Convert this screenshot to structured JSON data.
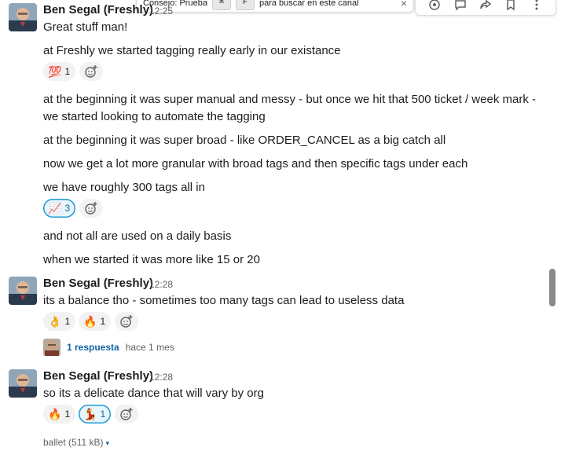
{
  "tooltip": {
    "prefix": "Consejo: Prueba",
    "key1": "⌘",
    "key2": "F",
    "suffix": "para buscar en este canal",
    "close": "×"
  },
  "messages": [
    {
      "author": "Ben Segal (Freshly)",
      "time": "12:25",
      "lines": [
        "Great stuff man!",
        "at Freshly we started tagging really early in our existance"
      ]
    },
    {
      "lines": [
        "at the beginning it was super manual and messy - but once we hit that 500 ticket / week mark -",
        "we started looking to automate the tagging",
        "at the beginning it was super broad - like ORDER_CANCEL as a big catch all",
        "now we get a lot more granular with broad tags and then specific tags under each",
        "we have roughly 300 tags all in"
      ]
    },
    {
      "lines": [
        "and not all are used on a daily basis",
        "when we started it was more like 15 or 20"
      ]
    },
    {
      "author": "Ben Segal (Freshly)",
      "time": "12:28",
      "lines": [
        "its a balance tho - sometimes too many tags can lead to useless data"
      ]
    },
    {
      "author": "Ben Segal (Freshly)",
      "time": "12:28",
      "lines": [
        "so its a delicate dance that will vary by org"
      ]
    }
  ],
  "reactions": {
    "r1": {
      "emoji": "💯",
      "count": "1"
    },
    "r2": {
      "emoji": "📈",
      "count": "3"
    },
    "r3a": {
      "emoji": "👌",
      "count": "1"
    },
    "r3b": {
      "emoji": "🔥",
      "count": "1"
    },
    "r4a": {
      "emoji": "🔥",
      "count": "1"
    },
    "r4b": {
      "emoji": "💃",
      "count": "1"
    }
  },
  "thread": {
    "replies": "1 respuesta",
    "time": "hace 1 mes"
  },
  "file": {
    "name": "ballet (511 kB)",
    "caret": "▾"
  },
  "colors": {
    "link": "#1264a3",
    "active_reaction_border": "#1d9bd1",
    "muted_text": "#616061"
  }
}
